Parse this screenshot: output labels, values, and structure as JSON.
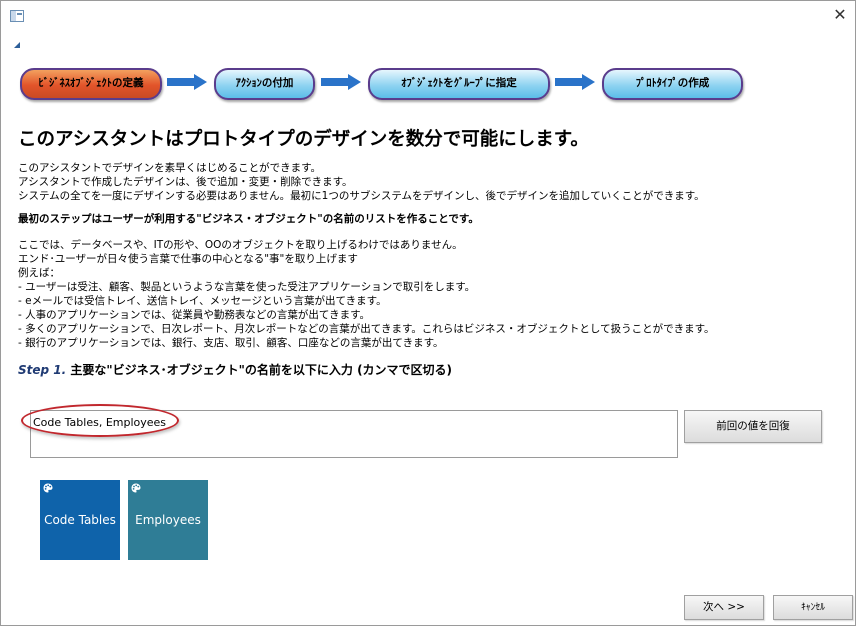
{
  "window": {
    "close_glyph": "✕"
  },
  "wizard_steps": [
    {
      "label": "ﾋﾞｼﾞﾈｽｵﾌﾞｼﾞｪｸﾄの定義",
      "state": "active"
    },
    {
      "label": "ｱｸｼｮﾝの付加",
      "state": "inactive"
    },
    {
      "label": "ｵﾌﾞｼﾞｪｸﾄをｸﾞﾙｰﾌﾟに指定",
      "state": "inactive"
    },
    {
      "label": "ﾌﾟﾛﾄﾀｲﾌﾟの作成",
      "state": "inactive"
    }
  ],
  "colors": {
    "active_step": "#e2542a",
    "inactive_step": "#8fd3f1",
    "step_border": "#5a3c8c",
    "arrow": "#2a73c9",
    "highlight": "#c1272d",
    "tile_code_tables": "#0f63aa",
    "tile_employees": "#2f7d96"
  },
  "content": {
    "headline": "このアシスタントはプロトタイプのデザインを数分で可能にします。",
    "intro_lines": [
      "このアシスタントでデザインを素早くはじめることができます。",
      "アシスタントで作成したデザインは、後で追加・変更・削除できます。",
      "システムの全てを一度にデザインする必要はありません。最初に1つのサブシステムをデザインし、後でデザインを追加していくことができます。"
    ],
    "first_step": "最初のステップはユーザーが利用する\"ビジネス・オブジェクト\"の名前のリストを作ることです。",
    "example_lines": [
      "ここでは、データベースや、ITの形や、OOのオブジェクトを取り上げるわけではありません。",
      "エンド･ユーザーが日々使う言葉で仕事の中心となる\"事\"を取り上げます",
      "例えば：",
      "- ユーザーは受注、顧客、製品というような言葉を使った受注アプリケーションで取引をします。",
      "- eメールでは受信トレイ、送信トレイ、メッセージという言葉が出てきます。",
      "- 人事のアプリケーションでは、従業員や勤務表などの言葉が出てきます。",
      "- 多くのアプリケーションで、日次レポート、月次レポートなどの言葉が出てきます。これらはビジネス・オブジェクトとして扱うことができます。",
      "- 銀行のアプリケーションでは、銀行、支店、取引、顧客、口座などの言葉が出てきます。"
    ],
    "step_label_num": "Step 1.",
    "step_label_text": " 主要な\"ビジネス･オブジェクト\"の名前を以下に入力 (カンマで区切る)"
  },
  "input": {
    "value": "Code Tables, Employees",
    "placeholder": ""
  },
  "buttons": {
    "restore": "前回の値を回復",
    "next": "次へ >>",
    "cancel": "ｷｬﾝｾﾙ"
  },
  "tiles": [
    {
      "label": "Code Tables",
      "icon": "palette-icon"
    },
    {
      "label": "Employees",
      "icon": "palette-icon"
    }
  ]
}
